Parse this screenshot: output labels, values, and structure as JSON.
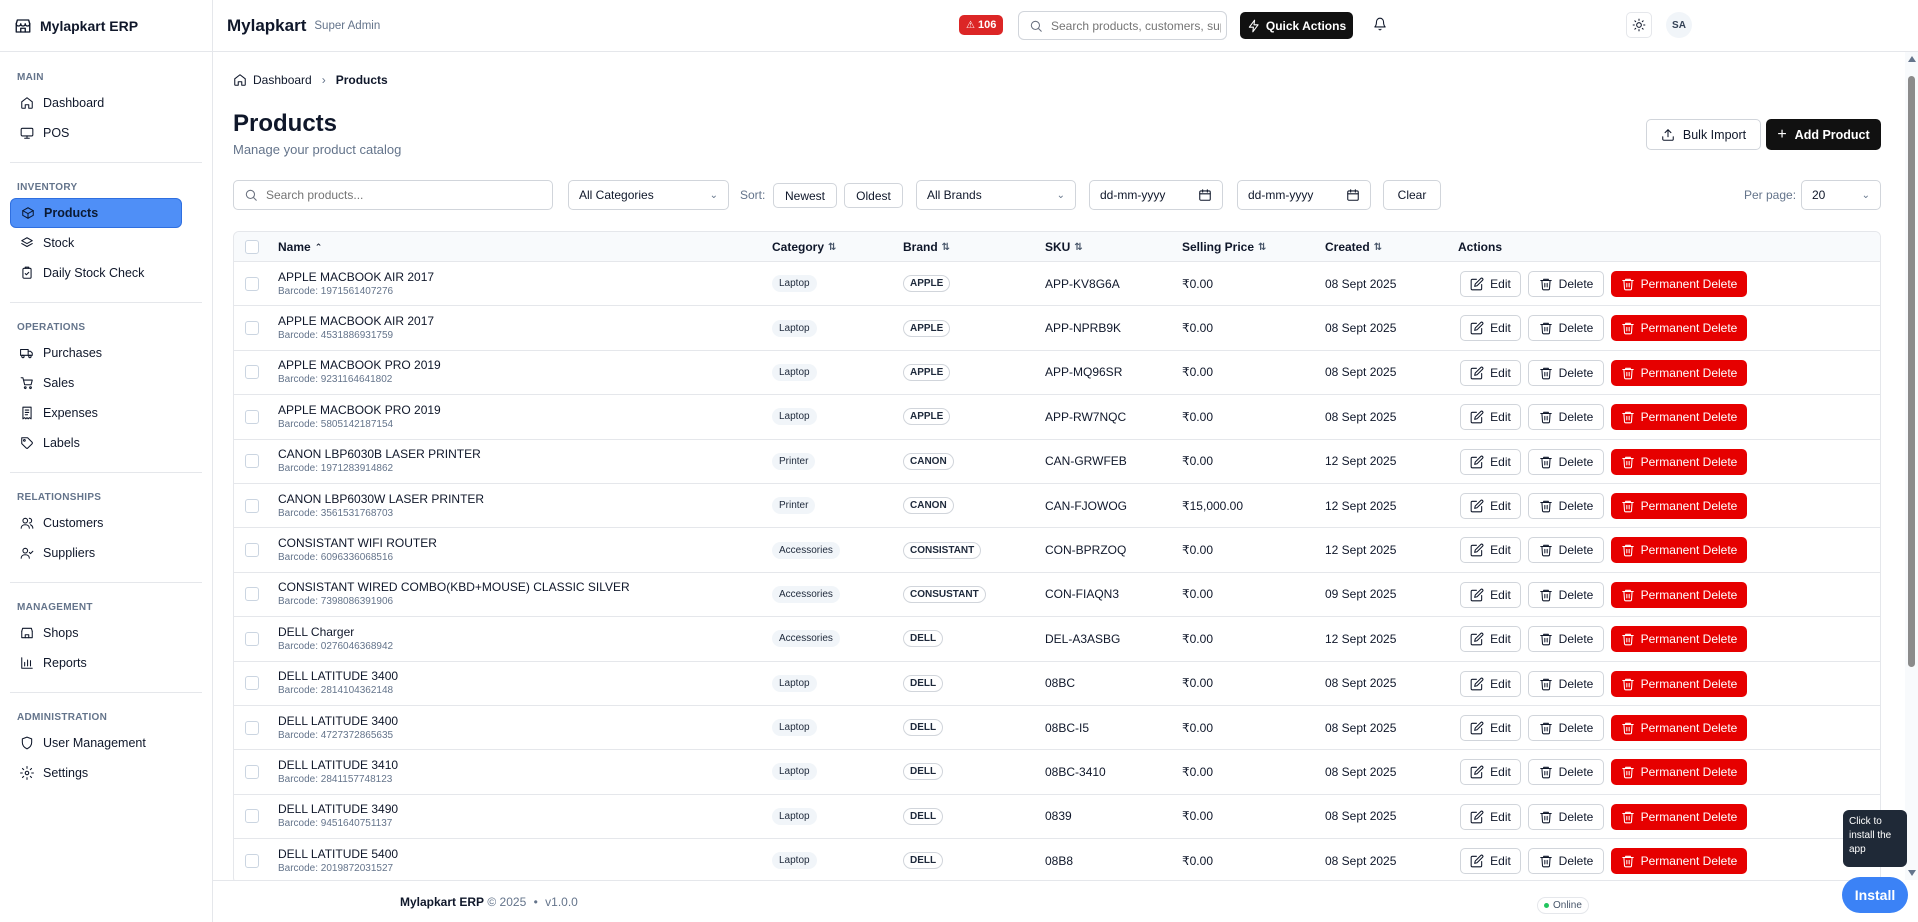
{
  "app": {
    "name": "Mylapkart ERP"
  },
  "header": {
    "title": "Mylapkart",
    "role": "Super Admin",
    "alert_count": "106",
    "search_placeholder": "Search products, customers, suppliers...",
    "quick_actions": "Quick Actions",
    "avatar_initials": "SA"
  },
  "sidebar": {
    "sections": [
      {
        "heading": "MAIN",
        "items": [
          {
            "label": "Dashboard",
            "icon": "home-icon"
          },
          {
            "label": "POS",
            "icon": "monitor-icon"
          }
        ]
      },
      {
        "heading": "INVENTORY",
        "items": [
          {
            "label": "Products",
            "icon": "package-icon",
            "active": true
          },
          {
            "label": "Stock",
            "icon": "stack-icon"
          },
          {
            "label": "Daily Stock Check",
            "icon": "clipboard-check-icon"
          }
        ]
      },
      {
        "heading": "OPERATIONS",
        "items": [
          {
            "label": "Purchases",
            "icon": "truck-icon"
          },
          {
            "label": "Sales",
            "icon": "cart-icon"
          },
          {
            "label": "Expenses",
            "icon": "receipt-icon"
          },
          {
            "label": "Labels",
            "icon": "tag-icon"
          }
        ]
      },
      {
        "heading": "RELATIONSHIPS",
        "items": [
          {
            "label": "Customers",
            "icon": "users-icon"
          },
          {
            "label": "Suppliers",
            "icon": "user-check-icon"
          }
        ]
      },
      {
        "heading": "MANAGEMENT",
        "items": [
          {
            "label": "Shops",
            "icon": "store-icon"
          },
          {
            "label": "Reports",
            "icon": "bar-chart-icon"
          }
        ]
      },
      {
        "heading": "ADMINISTRATION",
        "items": [
          {
            "label": "User Management",
            "icon": "shield-icon"
          },
          {
            "label": "Settings",
            "icon": "gear-icon"
          }
        ]
      }
    ]
  },
  "breadcrumb": {
    "home": "Dashboard",
    "current": "Products"
  },
  "page": {
    "title": "Products",
    "subtitle": "Manage your product catalog",
    "bulk_import": "Bulk Import",
    "add_product": "Add Product"
  },
  "filters": {
    "search_placeholder": "Search products...",
    "category": "All Categories",
    "sort_label": "Sort:",
    "sort_newest": "Newest",
    "sort_oldest": "Oldest",
    "brand": "All Brands",
    "date_from": "dd-mm-yyyy",
    "date_to": "dd-mm-yyyy",
    "clear": "Clear",
    "per_page_label": "Per page:",
    "per_page": "20"
  },
  "table": {
    "columns": {
      "name": "Name",
      "category": "Category",
      "brand": "Brand",
      "sku": "SKU",
      "price": "Selling Price",
      "created": "Created",
      "actions": "Actions"
    },
    "actions": {
      "edit": "Edit",
      "delete": "Delete",
      "permanent_delete": "Permanent Delete"
    },
    "rows": [
      {
        "name": "APPLE MACBOOK AIR 2017",
        "barcode": "Barcode: 1971561407276",
        "category": "Laptop",
        "brand": "APPLE",
        "sku": "APP-KV8G6A",
        "price": "₹0.00",
        "created": "08 Sept 2025"
      },
      {
        "name": "APPLE MACBOOK AIR 2017",
        "barcode": "Barcode: 4531886931759",
        "category": "Laptop",
        "brand": "APPLE",
        "sku": "APP-NPRB9K",
        "price": "₹0.00",
        "created": "08 Sept 2025"
      },
      {
        "name": "APPLE MACBOOK PRO 2019",
        "barcode": "Barcode: 9231164641802",
        "category": "Laptop",
        "brand": "APPLE",
        "sku": "APP-MQ96SR",
        "price": "₹0.00",
        "created": "08 Sept 2025"
      },
      {
        "name": "APPLE MACBOOK PRO 2019",
        "barcode": "Barcode: 5805142187154",
        "category": "Laptop",
        "brand": "APPLE",
        "sku": "APP-RW7NQC",
        "price": "₹0.00",
        "created": "08 Sept 2025"
      },
      {
        "name": "CANON LBP6030B LASER PRINTER",
        "barcode": "Barcode: 1971283914862",
        "category": "Printer",
        "brand": "CANON",
        "sku": "CAN-GRWFEB",
        "price": "₹0.00",
        "created": "12 Sept 2025"
      },
      {
        "name": "CANON LBP6030W LASER PRINTER",
        "barcode": "Barcode: 3561531768703",
        "category": "Printer",
        "brand": "CANON",
        "sku": "CAN-FJOWOG",
        "price": "₹15,000.00",
        "created": "12 Sept 2025"
      },
      {
        "name": "CONSISTANT WIFI ROUTER",
        "barcode": "Barcode: 6096336068516",
        "category": "Accessories",
        "brand": "CONSISTANT",
        "sku": "CON-BPRZOQ",
        "price": "₹0.00",
        "created": "12 Sept 2025"
      },
      {
        "name": "CONSISTANT WIRED COMBO(KBD+MOUSE) CLASSIC SILVER",
        "barcode": "Barcode: 7398086391906",
        "category": "Accessories",
        "brand": "CONSUSTANT",
        "sku": "CON-FIAQN3",
        "price": "₹0.00",
        "created": "09 Sept 2025"
      },
      {
        "name": "DELL Charger",
        "barcode": "Barcode: 0276046368942",
        "category": "Accessories",
        "brand": "DELL",
        "sku": "DEL-A3ASBG",
        "price": "₹0.00",
        "created": "12 Sept 2025"
      },
      {
        "name": "DELL LATITUDE 3400",
        "barcode": "Barcode: 2814104362148",
        "category": "Laptop",
        "brand": "DELL",
        "sku": "08BC",
        "price": "₹0.00",
        "created": "08 Sept 2025"
      },
      {
        "name": "DELL LATITUDE 3400",
        "barcode": "Barcode: 4727372865635",
        "category": "Laptop",
        "brand": "DELL",
        "sku": "08BC-I5",
        "price": "₹0.00",
        "created": "08 Sept 2025"
      },
      {
        "name": "DELL LATITUDE 3410",
        "barcode": "Barcode: 2841157748123",
        "category": "Laptop",
        "brand": "DELL",
        "sku": "08BC-3410",
        "price": "₹0.00",
        "created": "08 Sept 2025"
      },
      {
        "name": "DELL LATITUDE 3490",
        "barcode": "Barcode: 9451640751137",
        "category": "Laptop",
        "brand": "DELL",
        "sku": "0839",
        "price": "₹0.00",
        "created": "08 Sept 2025"
      },
      {
        "name": "DELL LATITUDE 5400",
        "barcode": "Barcode: 2019872031527",
        "category": "Laptop",
        "brand": "DELL",
        "sku": "08B8",
        "price": "₹0.00",
        "created": "08 Sept 2025"
      }
    ]
  },
  "footer": {
    "app": "Mylapkart ERP",
    "copyright": "© 2025",
    "separator": "•",
    "version": "v1.0.0",
    "status": "Online"
  },
  "install": {
    "tip": "Click to install the app",
    "button": "Install"
  },
  "colors": {
    "active_nav": "#4f8ff7",
    "danger": "#e60000",
    "primary_dark": "#111111",
    "install": "#3b82f6"
  }
}
